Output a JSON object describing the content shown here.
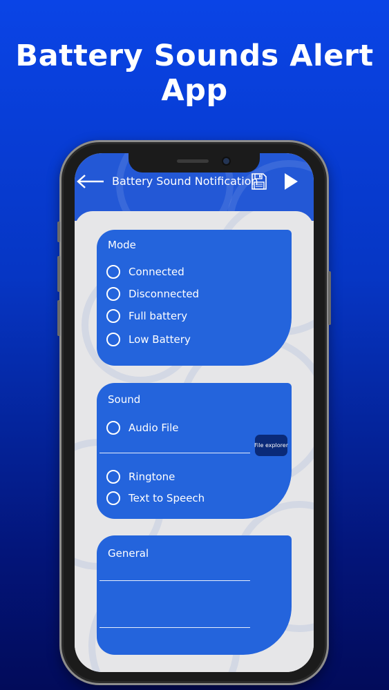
{
  "headline": "Battery Sounds Alert App",
  "app_bar": {
    "title": "Battery Sound Notification",
    "back_icon": "arrow-left-icon",
    "save_icon": "floppy-disk-icon",
    "play_icon": "play-icon"
  },
  "mode_card": {
    "title": "Mode",
    "options": [
      "Connected",
      "Disconnected",
      "Full battery",
      "Low Battery"
    ]
  },
  "sound_card": {
    "title": "Sound",
    "options": [
      "Audio File",
      "Ringtone",
      "Text to Speech"
    ],
    "file_button": "File explorer"
  },
  "general_card": {
    "title": "General"
  },
  "colors": {
    "background_top": "#0a44e6",
    "background_bottom": "#020b5a",
    "app_bar": "#2358d6",
    "card": "#2464dc",
    "button": "#0a2a78",
    "screen": "#e6e6e8"
  }
}
